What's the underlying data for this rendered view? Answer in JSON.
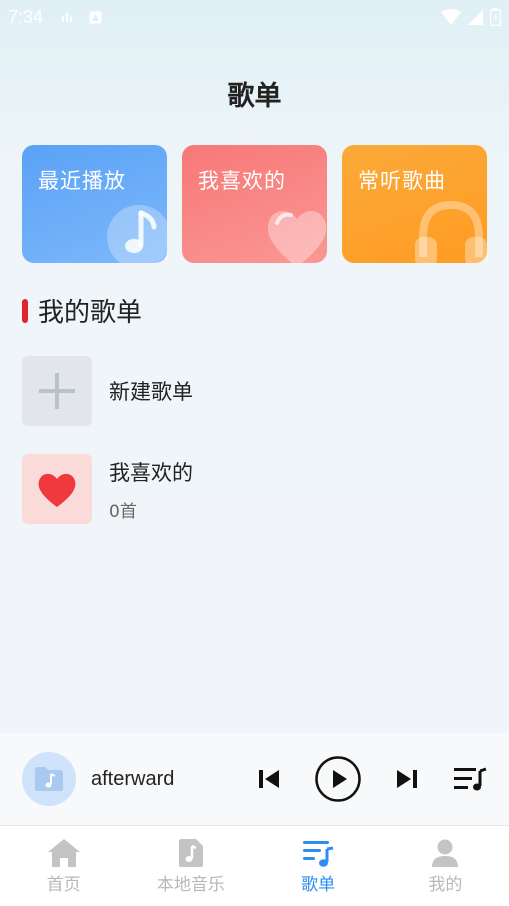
{
  "status_bar": {
    "time": "7:34"
  },
  "header": {
    "title": "歌单"
  },
  "quick_cards": [
    {
      "label": "最近播放",
      "icon": "music-note-icon"
    },
    {
      "label": "我喜欢的",
      "icon": "heart-icon"
    },
    {
      "label": "常听歌曲",
      "icon": "headphones-icon"
    }
  ],
  "section": {
    "title": "我的歌单"
  },
  "playlists": [
    {
      "name": "新建歌单",
      "icon": "plus-icon"
    },
    {
      "name": "我喜欢的",
      "count": "0首",
      "icon": "heart-icon"
    }
  ],
  "player": {
    "song_title": "afterward"
  },
  "tabs": [
    {
      "label": "首页",
      "icon": "home-icon"
    },
    {
      "label": "本地音乐",
      "icon": "music-file-icon"
    },
    {
      "label": "歌单",
      "icon": "playlist-icon",
      "active": true
    },
    {
      "label": "我的",
      "icon": "user-icon"
    }
  ],
  "colors": {
    "accent": "#2f8cf0",
    "section_marker": "#e0252b",
    "card_recent": "#5aa2f6",
    "card_fav": "#f77877",
    "card_often": "#fbaa3a"
  }
}
